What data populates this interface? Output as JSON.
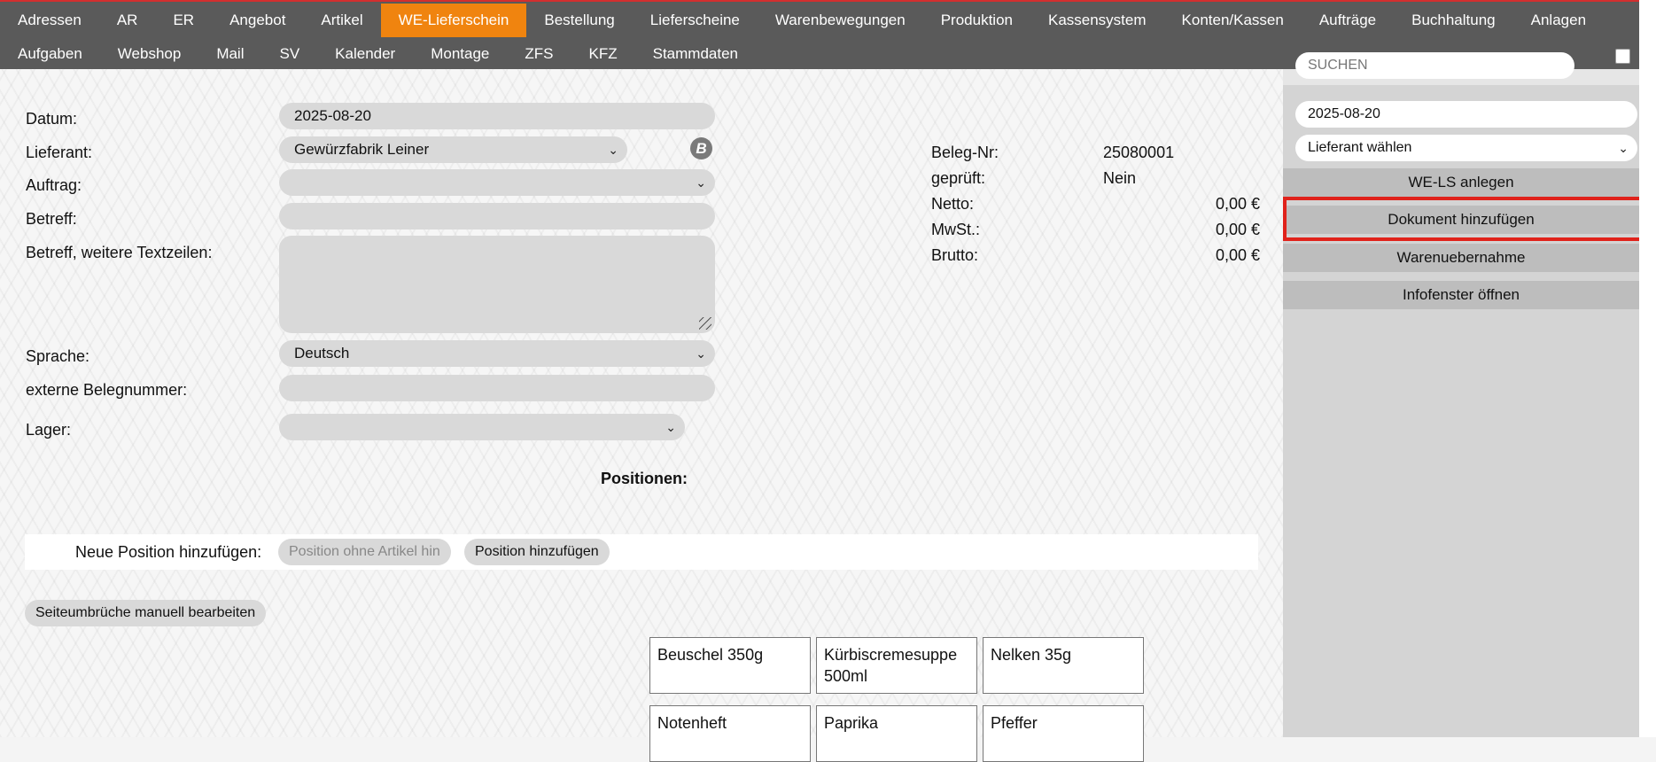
{
  "nav": {
    "row1": [
      "Adressen",
      "AR",
      "ER",
      "Angebot",
      "Artikel",
      "WE-Lieferschein",
      "Bestellung",
      "Lieferscheine",
      "Warenbewegungen",
      "Produktion",
      "Kassensystem",
      "Konten/Kassen",
      "Aufträge",
      "Buchhaltung",
      "Anlagen"
    ],
    "row2": [
      "Aufgaben",
      "Webshop",
      "Mail",
      "SV",
      "Kalender",
      "Montage",
      "ZFS",
      "KFZ",
      "Stammdaten"
    ],
    "active": "WE-Lieferschein"
  },
  "form": {
    "datum_label": "Datum:",
    "datum_value": "2025-08-20",
    "lieferant_label": "Lieferant:",
    "lieferant_value": "Gewürzfabrik Leiner",
    "auftrag_label": "Auftrag:",
    "auftrag_value": "",
    "betreff_label": "Betreff:",
    "betreff_value": "",
    "betreff_weitere_label": "Betreff, weitere Textzeilen:",
    "betreff_weitere_value": "",
    "sprache_label": "Sprache:",
    "sprache_value": "Deutsch",
    "extbeleg_label": "externe Belegnummer:",
    "extbeleg_value": "",
    "lager_label": "Lager:",
    "lager_value": "",
    "b_icon": "B"
  },
  "info": {
    "belegnr_label": "Beleg-Nr:",
    "belegnr_value": "25080001",
    "geprueft_label": "geprüft:",
    "geprueft_value": "Nein",
    "netto_label": "Netto:",
    "netto_value": "0,00 €",
    "mwst_label": "MwSt.:",
    "mwst_value": "0,00 €",
    "brutto_label": "Brutto:",
    "brutto_value": "0,00 €"
  },
  "positions": {
    "heading": "Positionen:",
    "new_label": "Neue Position hinzufügen:",
    "new_placeholder": "Position ohne Artikel hin",
    "add_button": "Position hinzufügen",
    "pagebreak_button": "Seiteumbrüche manuell bearbeiten"
  },
  "tiles": [
    "Beuschel 350g",
    "Kürbiscremesuppe 500ml",
    "Nelken 35g",
    "Notenheft",
    "Paprika",
    "Pfeffer"
  ],
  "sidebar": {
    "search_placeholder": "SUCHEN",
    "date_value": "2025-08-20",
    "lieferant_select": "Lieferant wählen",
    "btn_wels": "WE-LS anlegen",
    "btn_dokument": "Dokument hinzufügen",
    "btn_warenuebernahme": "Warenuebernahme",
    "btn_infofenster": "Infofenster öffnen"
  },
  "colors": {
    "nav_bg": "#5a5a5a",
    "nav_active": "#f0840f",
    "highlight": "#e0221b"
  }
}
